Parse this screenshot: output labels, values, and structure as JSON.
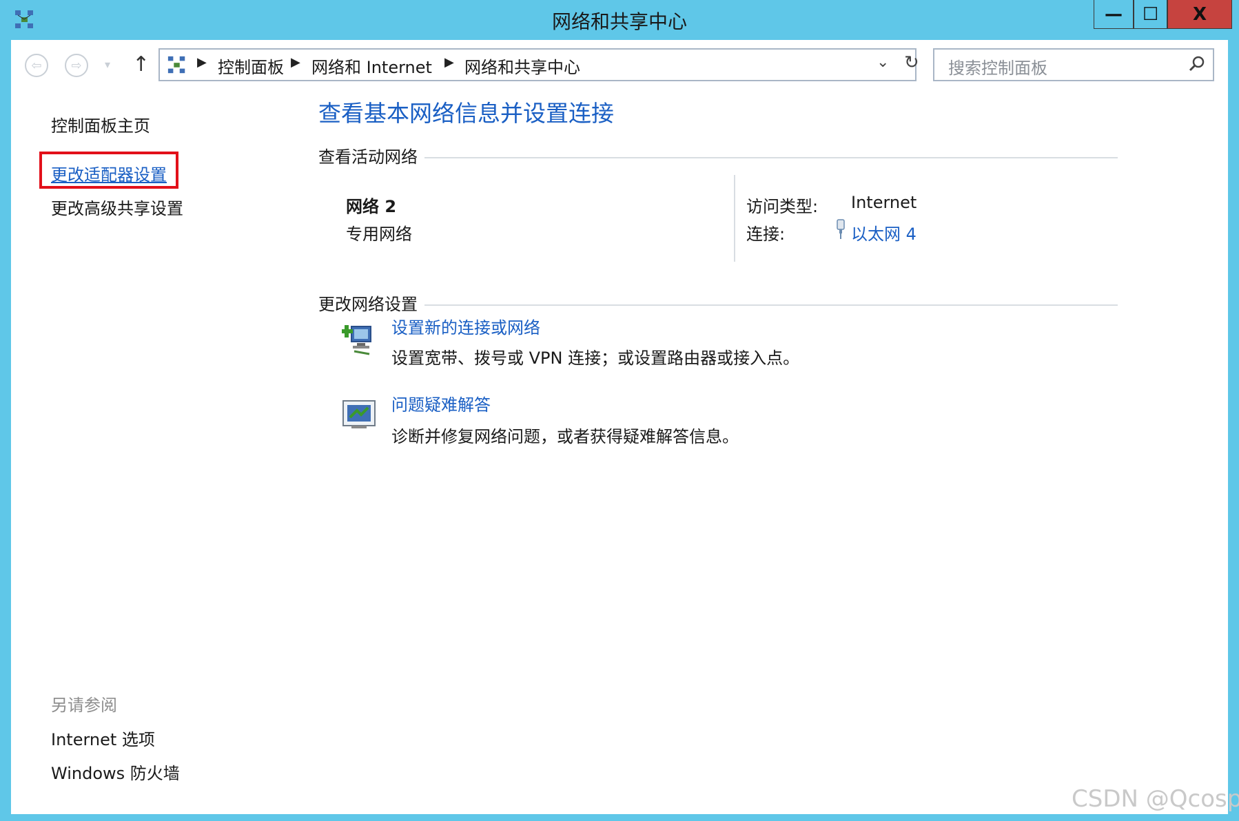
{
  "window": {
    "title": "网络和共享中心",
    "minimize_label": "—",
    "maximize_label": "☐",
    "close_label": "X"
  },
  "nav": {
    "breadcrumbs": [
      "控制面板",
      "网络和 Internet",
      "网络和共享中心"
    ],
    "search_placeholder": "搜索控制面板"
  },
  "sidebar": {
    "home": "控制面板主页",
    "change_adapter": "更改适配器设置",
    "change_advanced": "更改高级共享设置",
    "see_also": "另请参阅",
    "internet_options": "Internet 选项",
    "firewall": "Windows 防火墙"
  },
  "main": {
    "title": "查看基本网络信息并设置连接",
    "active_header": "查看活动网络",
    "network_name": "网络  2",
    "network_type": "专用网络",
    "access_type_label": "访问类型:",
    "access_type_value": "Internet",
    "connection_label": "连接:",
    "connection_value": "以太网 4",
    "change_header": "更改网络设置",
    "tasks": [
      {
        "link": "设置新的连接或网络",
        "desc": "设置宽带、拨号或 VPN 连接；或设置路由器或接入点。"
      },
      {
        "link": "问题疑难解答",
        "desc": "诊断并修复网络问题，或者获得疑难解答信息。"
      }
    ]
  },
  "watermark": "CSDN @Qcosp",
  "colors": {
    "frame": "#5fc7e8",
    "link": "#1a5fc4",
    "highlight": "#e2101a",
    "close": "#c6433f"
  }
}
